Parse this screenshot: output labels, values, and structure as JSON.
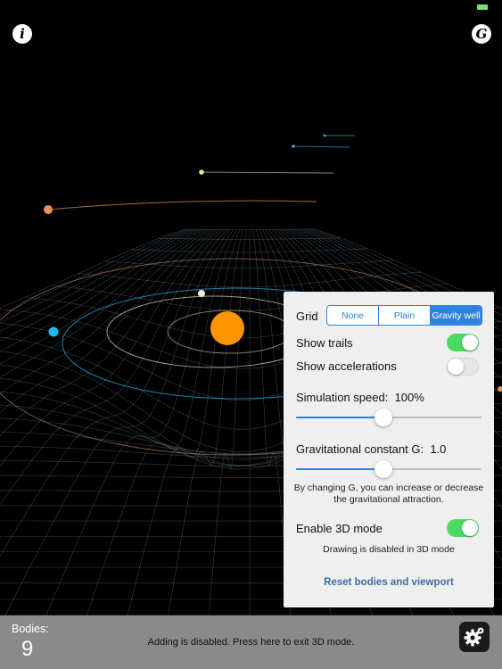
{
  "top": {
    "info_glyph": "i",
    "g_glyph": "G"
  },
  "panel": {
    "grid_label": "Grid",
    "grid_options": [
      "None",
      "Plain",
      "Gravity well"
    ],
    "grid_selected": "Gravity well",
    "show_trails_label": "Show trails",
    "show_trails_on": true,
    "show_accelerations_label": "Show accelerations",
    "show_accelerations_on": false,
    "speed_label": "Simulation speed:",
    "speed_value": "100%",
    "speed_fraction": 0.47,
    "g_label": "Gravitational constant G:",
    "g_value": "1.0",
    "g_fraction": 0.47,
    "g_note": "By changing G, you can increase or decrease the gravitational attraction.",
    "enable_3d_label": "Enable 3D mode",
    "enable_3d_on": true,
    "drawing_note": "Drawing is disabled in 3D mode",
    "reset_label": "Reset bodies and viewport"
  },
  "bottom": {
    "bodies_label": "Bodies:",
    "bodies_count": "9",
    "status_text": "Adding is disabled. Press here to exit 3D mode."
  },
  "colors": {
    "accent": "#2f83e0",
    "toggle_on": "#4cd964",
    "sun": "#ff9500",
    "planet_blue": "#1fb8f0",
    "planet_orange": "#e8935a",
    "planet_cream": "#f2eacb"
  }
}
